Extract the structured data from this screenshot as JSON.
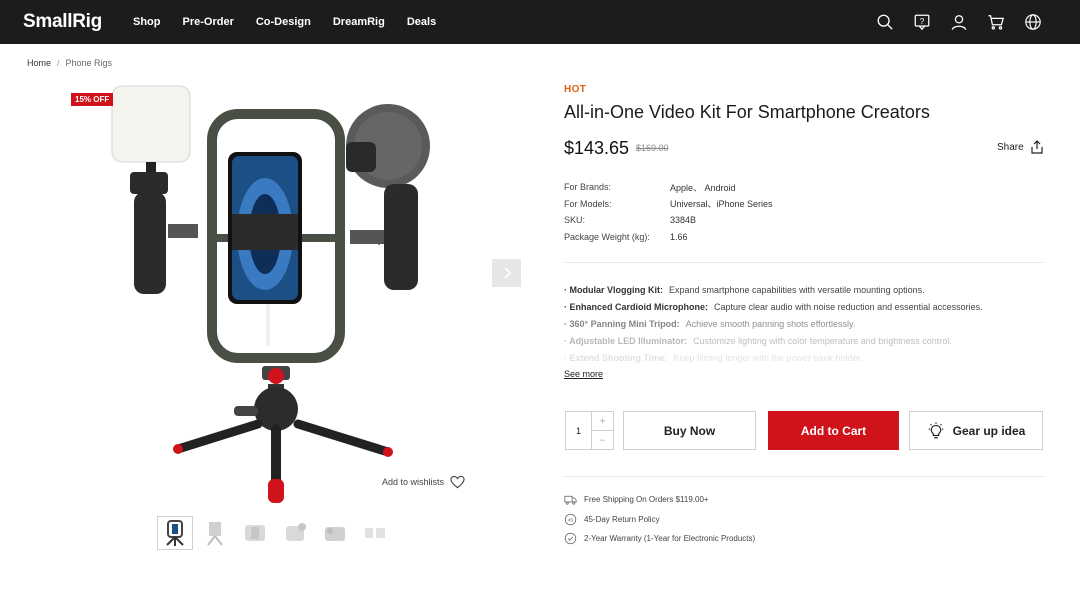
{
  "header": {
    "logo": "SmallRig",
    "nav": [
      "Shop",
      "Pre-Order",
      "Co-Design",
      "DreamRig",
      "Deals"
    ],
    "icons": [
      "search-icon",
      "support-icon",
      "account-icon",
      "cart-icon",
      "language-icon"
    ]
  },
  "breadcrumb": {
    "home": "Home",
    "separator": "/",
    "current": "Phone Rigs"
  },
  "gallery": {
    "badge": "15% OFF",
    "wishlist_label": "Add to wishlists",
    "thumbnail_count": 6,
    "active_thumbnail": 1
  },
  "product": {
    "tag": "HOT",
    "title": "All-in-One Video Kit For Smartphone Creators",
    "price": "$143.65",
    "old_price": "$169.00",
    "share_label": "Share",
    "specs": [
      {
        "label": "For Brands:",
        "value": "Apple、 Android"
      },
      {
        "label": "For Models:",
        "value": "Universal、iPhone Series"
      },
      {
        "label": "SKU:",
        "value": "3384B"
      },
      {
        "label": "Package Weight (kg):",
        "value": "1.66"
      }
    ],
    "features": [
      {
        "title": "· Modular Vlogging Kit:",
        "text": "Expand smartphone capabilities with versatile mounting options."
      },
      {
        "title": "· Enhanced Cardioid Microphone:",
        "text": "Capture clear audio with noise reduction and essential accessories."
      },
      {
        "title": "· 360° Panning Mini Tripod:",
        "text": "Achieve smooth panning shots effortlessly."
      },
      {
        "title": "· Adjustable LED Illuminator:",
        "text": "Customize lighting with color temperature and brightness control."
      },
      {
        "title": "· Extend Shooting Time:",
        "text": "Keep filming longer with the power bank holder."
      }
    ],
    "see_more": "See more",
    "quantity": "1",
    "qty_plus": "+",
    "qty_minus": "−",
    "buy_now": "Buy Now",
    "add_to_cart": "Add to Cart",
    "gear_up": "Gear up idea",
    "perks": [
      {
        "icon": "truck-icon",
        "text": "Free Shipping On Orders $119.00+"
      },
      {
        "icon": "return-icon",
        "text": "45-Day Return Policy"
      },
      {
        "icon": "warranty-icon",
        "text": "2-Year Warranty (1-Year for Electronic Products)"
      }
    ]
  },
  "colors": {
    "header_bg": "#1c1c1c",
    "accent_red": "#d0121b",
    "hot_orange": "#e26012"
  }
}
